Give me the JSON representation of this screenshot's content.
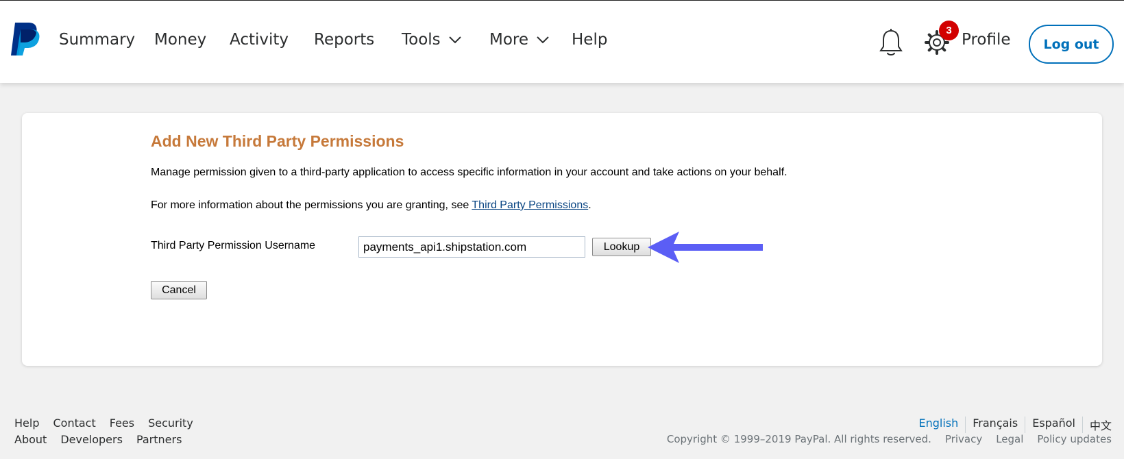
{
  "nav": {
    "items": [
      {
        "label": "Summary"
      },
      {
        "label": "Money"
      },
      {
        "label": "Activity"
      },
      {
        "label": "Reports"
      },
      {
        "label": "Tools"
      },
      {
        "label": "More"
      },
      {
        "label": "Help"
      }
    ],
    "notification_count": "3",
    "profile_label": "Profile",
    "logout_label": "Log out"
  },
  "main": {
    "heading": "Add New Third Party Permissions",
    "description": "Manage permission given to a third-party application to access specific information in your account and take actions on your behalf.",
    "info_prefix": "For more information about the permissions you are granting, see ",
    "info_link": "Third Party Permissions",
    "info_suffix": ".",
    "username_label": "Third Party Permission Username",
    "username_value": "payments_api1.shipstation.com",
    "lookup_label": "Lookup",
    "cancel_label": "Cancel"
  },
  "footer": {
    "links_row1": [
      "Help",
      "Contact",
      "Fees",
      "Security"
    ],
    "links_row2": [
      "About",
      "Developers",
      "Partners"
    ],
    "languages": [
      "English",
      "Français",
      "Español",
      "中文"
    ],
    "active_language": "English",
    "copyright": "Copyright © 1999–2019 PayPal. All rights reserved.",
    "legal_links": [
      "Privacy",
      "Legal",
      "Policy updates"
    ]
  },
  "colors": {
    "brand_dark": "#003087",
    "brand_light": "#009cde",
    "heading": "#c6793a",
    "link": "#0070ba",
    "badge": "#d20000",
    "arrow": "#5b5ef5"
  },
  "icons": {
    "logo": "paypal-logo",
    "bell": "bell-icon",
    "gear": "gear-icon",
    "arrow": "arrow-left-icon"
  }
}
